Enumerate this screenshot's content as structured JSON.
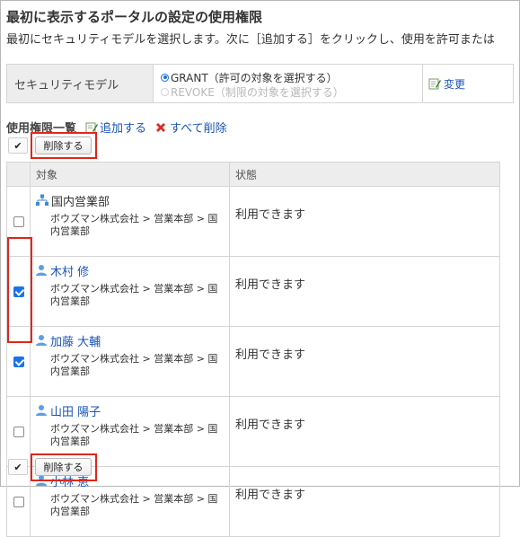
{
  "page": {
    "title": "最初に表示するポータルの設定の使用権限",
    "description": "最初にセキュリティモデルを選択します。次に［追加する］をクリックし、使用を許可または"
  },
  "security_model": {
    "label": "セキュリティモデル",
    "grant_label": "GRANT（許可の対象を選択する）",
    "revoke_label": "REVOKE（制限の対象を選択する）",
    "selected": "GRANT",
    "change_link": "変更"
  },
  "permissions": {
    "heading": "使用権限一覧",
    "add_link": "追加する",
    "delete_all_link": "すべて削除",
    "delete_button_label": "削除する",
    "check_all_glyph": "✔",
    "columns": {
      "target": "対象",
      "status": "状態"
    },
    "rows": [
      {
        "type": "organization",
        "name": "国内営業部",
        "path": "ボウズマン株式会社 > 営業本部 > 国内営業部",
        "status": "利用できます",
        "checked": false
      },
      {
        "type": "user",
        "name": "木村 修",
        "path": "ボウズマン株式会社 > 営業本部 > 国内営業部",
        "status": "利用できます",
        "checked": true
      },
      {
        "type": "user",
        "name": "加藤 大輔",
        "path": "ボウズマン株式会社 > 営業本部 > 国内営業部",
        "status": "利用できます",
        "checked": true
      },
      {
        "type": "user",
        "name": "山田 陽子",
        "path": "ボウズマン株式会社 > 営業本部 > 国内営業部",
        "status": "利用できます",
        "checked": false
      },
      {
        "type": "user",
        "name": "小林 恵",
        "path": "ボウズマン株式会社 > 営業本部 > 国内営業部",
        "status": "利用できます",
        "checked": false
      }
    ]
  },
  "colors": {
    "link": "#1a55b8",
    "highlight": "#e0261c",
    "header_bg": "#ededed",
    "checkbox_checked": "#1a73e8"
  }
}
